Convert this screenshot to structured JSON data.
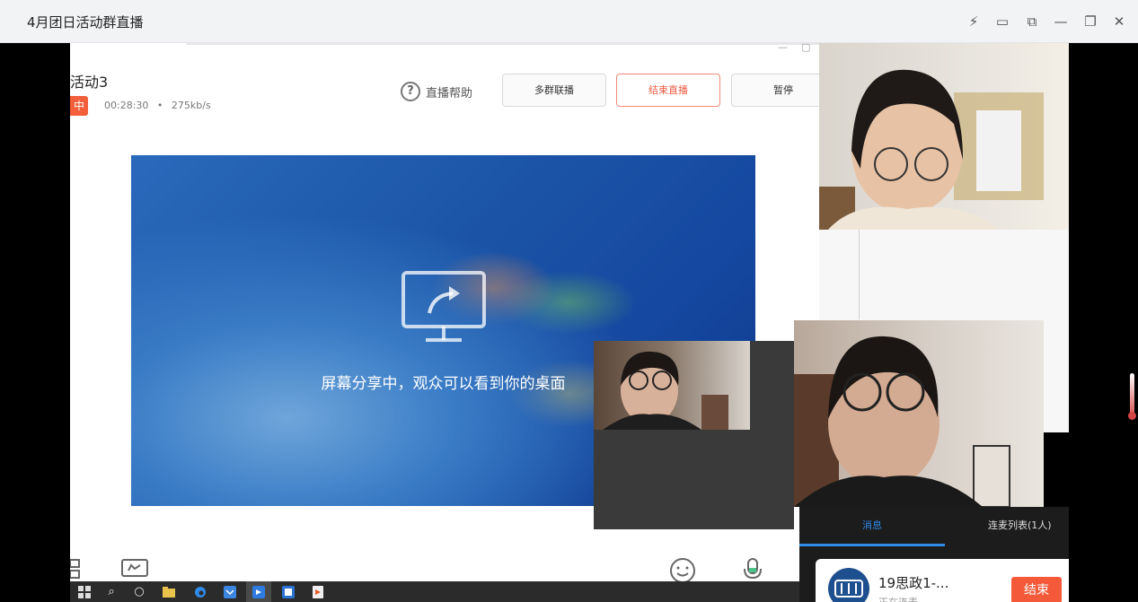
{
  "window": {
    "title": "4月团日活动群直播",
    "controls": {
      "flash": "⚡",
      "screen": "▭",
      "copy": "⧉",
      "minimize": "—",
      "restore": "❐",
      "close": "✕"
    }
  },
  "live": {
    "title": "活动3",
    "badge": "中",
    "duration": "00:28:30",
    "bitrate": "275kb/s",
    "separator": "•",
    "help_label": "直播帮助",
    "help_icon": "?",
    "buttons": {
      "multi_group": "多群联播",
      "end_live": "结束直播",
      "pause": "暂停"
    },
    "share_text": "屏幕分享中，观众可以看到你的桌面",
    "colors": {
      "accent_red": "#f25f3a",
      "share_blue": "#1c56a8",
      "tab_blue": "#2f8ae8"
    }
  },
  "panel": {
    "tabs": {
      "messages": "消息",
      "mic_list": "连麦列表(1人)"
    },
    "card": {
      "name": "19思政1-...",
      "status": "正在连麦",
      "end_button": "结束"
    }
  },
  "icons": {
    "layout": "layout-icon",
    "screen_share": "screen-share-icon",
    "emoji": "emoji-icon",
    "microphone": "microphone-icon"
  }
}
